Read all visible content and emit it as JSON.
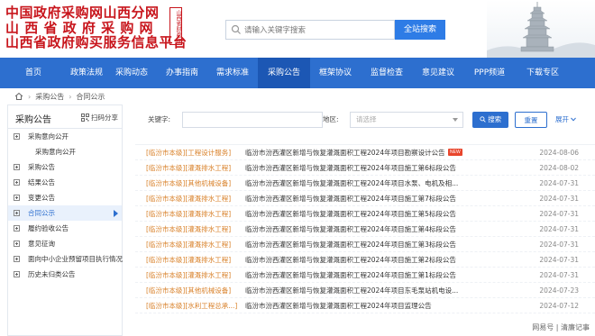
{
  "header": {
    "logo_lines": [
      "中国政府采购网山西分网",
      "山 西 省 政 府 采 购 网",
      "山西省政府购买服务信息平台"
    ],
    "seal_text": "山西省财政厅",
    "search": {
      "placeholder": "请输入关键字搜索",
      "button": "全站搜索"
    }
  },
  "nav": {
    "items": [
      "首页",
      "政策法规",
      "采购动态",
      "办事指南",
      "需求标准",
      "采购公告",
      "框架协议",
      "监督检查",
      "意见建议",
      "PPP频道",
      "下载专区"
    ],
    "active_index": 5
  },
  "breadcrumb": {
    "items": [
      "采购公告",
      "合同公示"
    ],
    "separator": "›"
  },
  "sidebar": {
    "title": "采购公告",
    "scan_label": "扫码分享",
    "items": [
      {
        "label": "采购意向公开",
        "level": 0,
        "active": false
      },
      {
        "label": "采购意向公开",
        "level": 1,
        "active": false
      },
      {
        "label": "采购公告",
        "level": 0,
        "active": false
      },
      {
        "label": "结果公告",
        "level": 0,
        "active": false
      },
      {
        "label": "变更公告",
        "level": 0,
        "active": false
      },
      {
        "label": "合同公示",
        "level": 0,
        "active": true
      },
      {
        "label": "履约验收公告",
        "level": 0,
        "active": false
      },
      {
        "label": "意见征询",
        "level": 0,
        "active": false
      },
      {
        "label": "面向中小企业预留项目执行情况",
        "level": 0,
        "active": false
      },
      {
        "label": "历史未归类公告",
        "level": 0,
        "active": false
      }
    ]
  },
  "filter": {
    "keyword_label": "关键字:",
    "keyword_value": "",
    "region_label": "地区:",
    "region_placeholder": "请选择",
    "search_button": "搜索",
    "reset_button": "重置",
    "expand_label": "展开"
  },
  "list": [
    {
      "tag": "[临汾市本级]",
      "category": "[工程设计服务]",
      "title": "临汾市汾西灌区新增与恢复灌溉面积工程2024年项目勘察设计公告",
      "is_new": true,
      "date": "2024-08-06"
    },
    {
      "tag": "[临汾市本级]",
      "category": "[灌溉排水工程]",
      "title": "临汾市汾西灌区新增与恢复灌溉面积工程2024年项目施工第6标段公告",
      "is_new": false,
      "date": "2024-08-02"
    },
    {
      "tag": "[临汾市本级]",
      "category": "[其他机械设备]",
      "title": "临汾市汾西灌区新增与恢复灌溉面积工程2024年项目水泵、电机及相...",
      "is_new": false,
      "date": "2024-07-31"
    },
    {
      "tag": "[临汾市本级]",
      "category": "[灌溉排水工程]",
      "title": "临汾市汾西灌区新增与恢复灌溉面积工程2024年项目施工第7标段公告",
      "is_new": false,
      "date": "2024-07-31"
    },
    {
      "tag": "[临汾市本级]",
      "category": "[灌溉排水工程]",
      "title": "临汾市汾西灌区新增与恢复灌溉面积工程2024年项目施工第5标段公告",
      "is_new": false,
      "date": "2024-07-31"
    },
    {
      "tag": "[临汾市本级]",
      "category": "[灌溉排水工程]",
      "title": "临汾市汾西灌区新增与恢复灌溉面积工程2024年项目施工第4标段公告",
      "is_new": false,
      "date": "2024-07-31"
    },
    {
      "tag": "[临汾市本级]",
      "category": "[灌溉排水工程]",
      "title": "临汾市汾西灌区新增与恢复灌溉面积工程2024年项目施工第3标段公告",
      "is_new": false,
      "date": "2024-07-31"
    },
    {
      "tag": "[临汾市本级]",
      "category": "[灌溉排水工程]",
      "title": "临汾市汾西灌区新增与恢复灌溉面积工程2024年项目施工第2标段公告",
      "is_new": false,
      "date": "2024-07-31"
    },
    {
      "tag": "[临汾市本级]",
      "category": "[灌溉排水工程]",
      "title": "临汾市汾西灌区新增与恢复灌溉面积工程2024年项目施工第1标段公告",
      "is_new": false,
      "date": "2024-07-31"
    },
    {
      "tag": "[临汾市本级]",
      "category": "[其他机械设备]",
      "title": "临汾市汾西灌区新增与恢复灌溉面积工程2024年项目东毛泵站机电设...",
      "is_new": false,
      "date": "2024-07-23"
    },
    {
      "tag": "[临汾市本级]",
      "category": "[水利工程总承...]",
      "title": "临汾市汾西灌区新增与恢复灌溉面积工程2024年项目监理公告",
      "is_new": false,
      "date": "2024-07-12"
    }
  ],
  "new_badge": "NEW",
  "watermark": "网易号 | 清廉记事",
  "colors": {
    "brand_red": "#c8161d",
    "nav_blue": "#2d6fcf",
    "nav_active": "#1c57b4",
    "tag_orange": "#d9822b"
  }
}
